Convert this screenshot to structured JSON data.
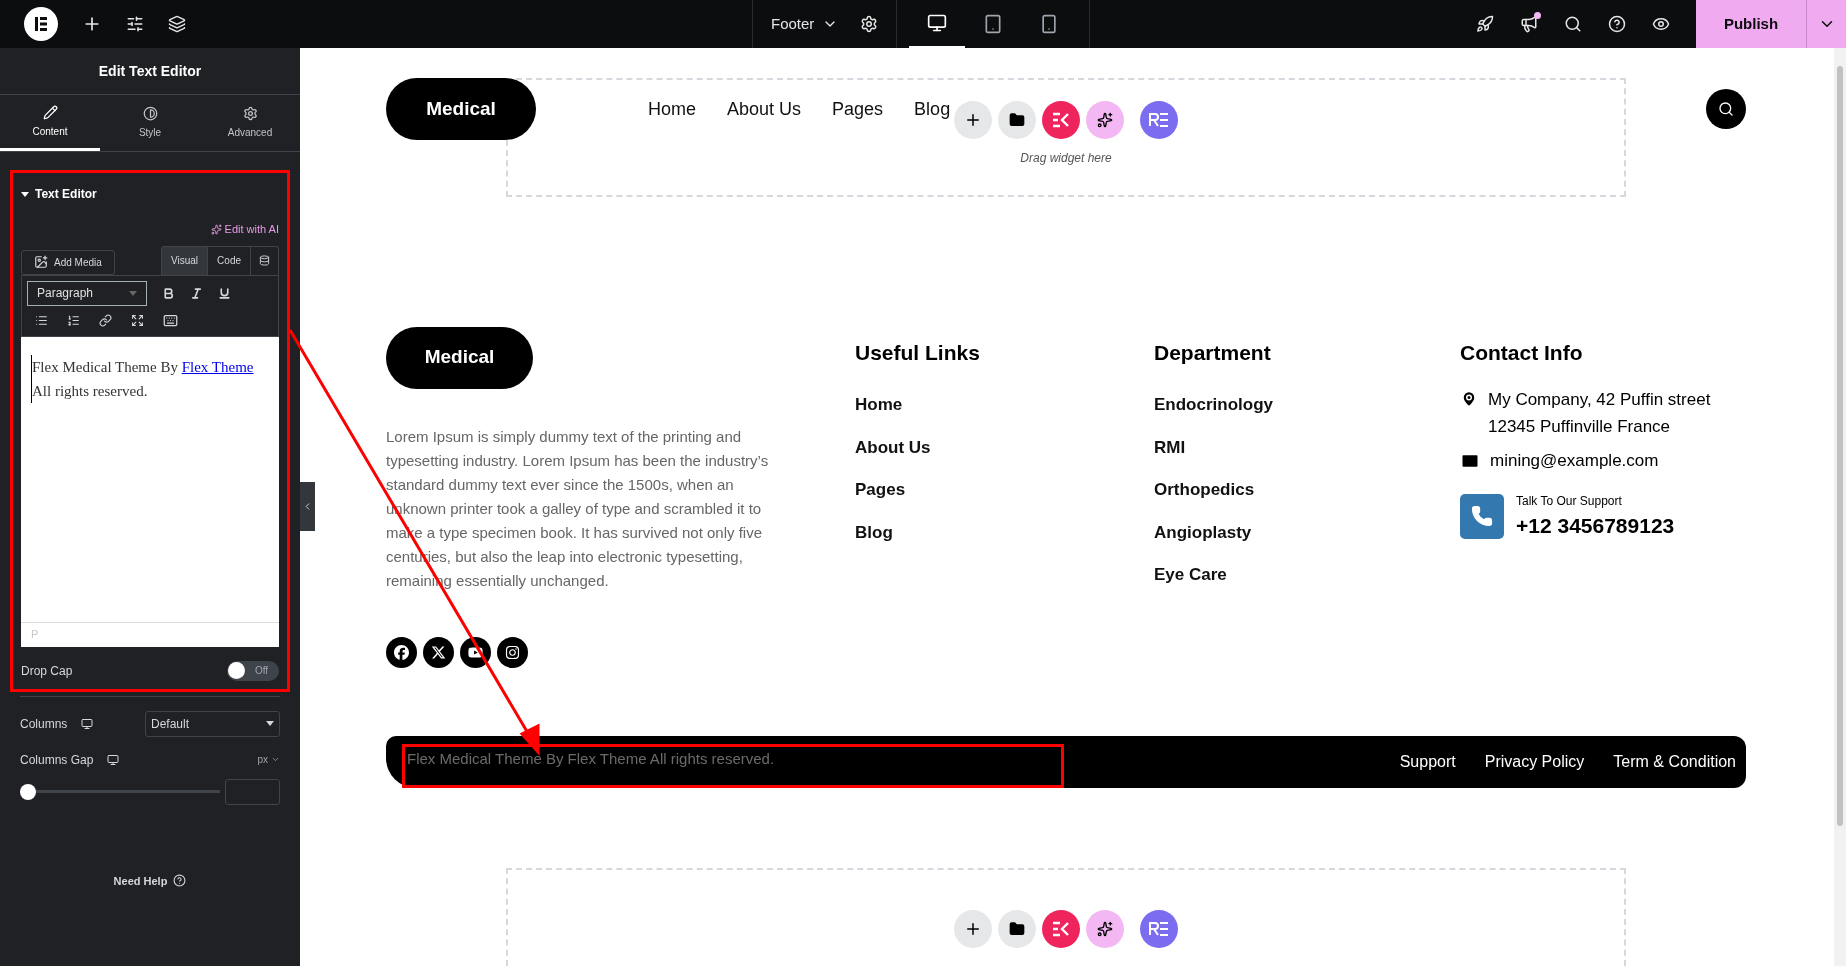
{
  "topbar": {
    "page_label": "Footer",
    "devices": [
      {
        "kind": "desktop",
        "selected": true
      },
      {
        "kind": "tablet",
        "selected": false
      },
      {
        "kind": "mobile",
        "selected": false
      }
    ],
    "publish": "Publish",
    "notification": true
  },
  "panel": {
    "title": "Edit Text Editor",
    "tabs": [
      {
        "kind": "content",
        "label": "Content",
        "selected": true
      },
      {
        "kind": "style",
        "label": "Style",
        "selected": false
      },
      {
        "kind": "advanced",
        "label": "Advanced",
        "selected": false
      }
    ],
    "section": {
      "title": "Text Editor",
      "expanded": true,
      "ai_label": "Edit with AI",
      "add_media": "Add Media",
      "editor_tabs": [
        {
          "label": "Visual",
          "selected": true
        },
        {
          "label": "Code",
          "selected": false
        }
      ],
      "format": "Paragraph",
      "content_before": "Flex Medical Theme By ",
      "content_link": "Flex Theme",
      "content_after": "All rights reserved.",
      "path": "P"
    },
    "drop_cap": {
      "label": "Drop Cap",
      "on": false,
      "state_text": "Off"
    },
    "columns": {
      "label": "Columns",
      "value": "Default"
    },
    "columns_gap": {
      "label": "Columns Gap",
      "unit": "px",
      "level": 0
    },
    "help": "Need Help"
  },
  "canvas": {
    "header": {
      "logo": "Medical",
      "nav": [
        "Home",
        "About Us",
        "Pages",
        "Blog"
      ]
    },
    "drop_zone": {
      "hint": "Drag widget here"
    },
    "footer": {
      "logo": "Medical",
      "about": "Lorem Ipsum is simply dummy text of the printing and typesetting industry. Lorem Ipsum has been the industry’s standard dummy text ever since the 1500s, when an unknown printer took a galley of type and scrambled it to make a type specimen book. It has survived not only five centuries, but also the leap into electronic typesetting, remaining essentially unchanged.",
      "socials": [
        {
          "kind": "facebook"
        },
        {
          "kind": "x"
        },
        {
          "kind": "youtube"
        },
        {
          "kind": "instagram"
        }
      ],
      "useful_links": {
        "title": "Useful Links",
        "items": [
          "Home",
          "About Us",
          "Pages",
          "Blog"
        ]
      },
      "department": {
        "title": "Department",
        "items": [
          "Endocrinology",
          "RMI",
          "Orthopedics",
          "Angioplasty",
          "Eye Care"
        ]
      },
      "contact": {
        "title": "Contact Info",
        "address": [
          "My Company, 42 Puffin street",
          "12345 Puffinville France"
        ],
        "email": "mining@example.com",
        "support_label": "Talk To Our Support",
        "phone": "+12 3456789123"
      },
      "bottom": {
        "copyright": "Flex Medical Theme By Flex Theme All rights reserved.",
        "links": [
          "Support",
          "Privacy Policy",
          "Term & Condition"
        ]
      }
    }
  }
}
